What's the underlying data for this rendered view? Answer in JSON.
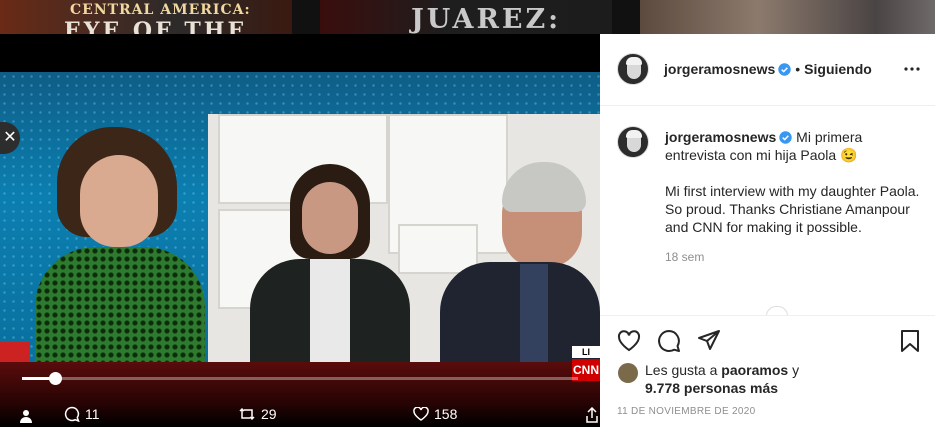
{
  "thumbnails": [
    {
      "line1": "CENTRAL AMERICA:",
      "line2": "EYE OF THE"
    },
    {
      "title": "JUAREZ:"
    },
    {
      "title": ""
    }
  ],
  "video": {
    "close_glyph": "✕",
    "live_label": "LI",
    "network_bug": "CNN",
    "progress": 0.06,
    "stats": {
      "comments": "11",
      "reposts": "29",
      "likes": "158"
    }
  },
  "post": {
    "username": "jorgeramosnews",
    "separator": "•",
    "follow_status": "Siguiendo",
    "caption_line1": "Mi primera entrevista con mi hija Paola 😉",
    "caption_line2": "Mi first interview with my daughter Paola. So proud. Thanks Christiane Amanpour and CNN for making it possible.",
    "time_ago": "18 sem",
    "likes_prefix": "Les gusta a",
    "likes_user": "paoramos",
    "likes_connector": "y",
    "likes_count": "9.778 personas más",
    "date": "11 DE NOVIEMBRE DE 2020"
  },
  "icons": {
    "verified_color": "#3897f0",
    "accent_red": "#d10000"
  }
}
